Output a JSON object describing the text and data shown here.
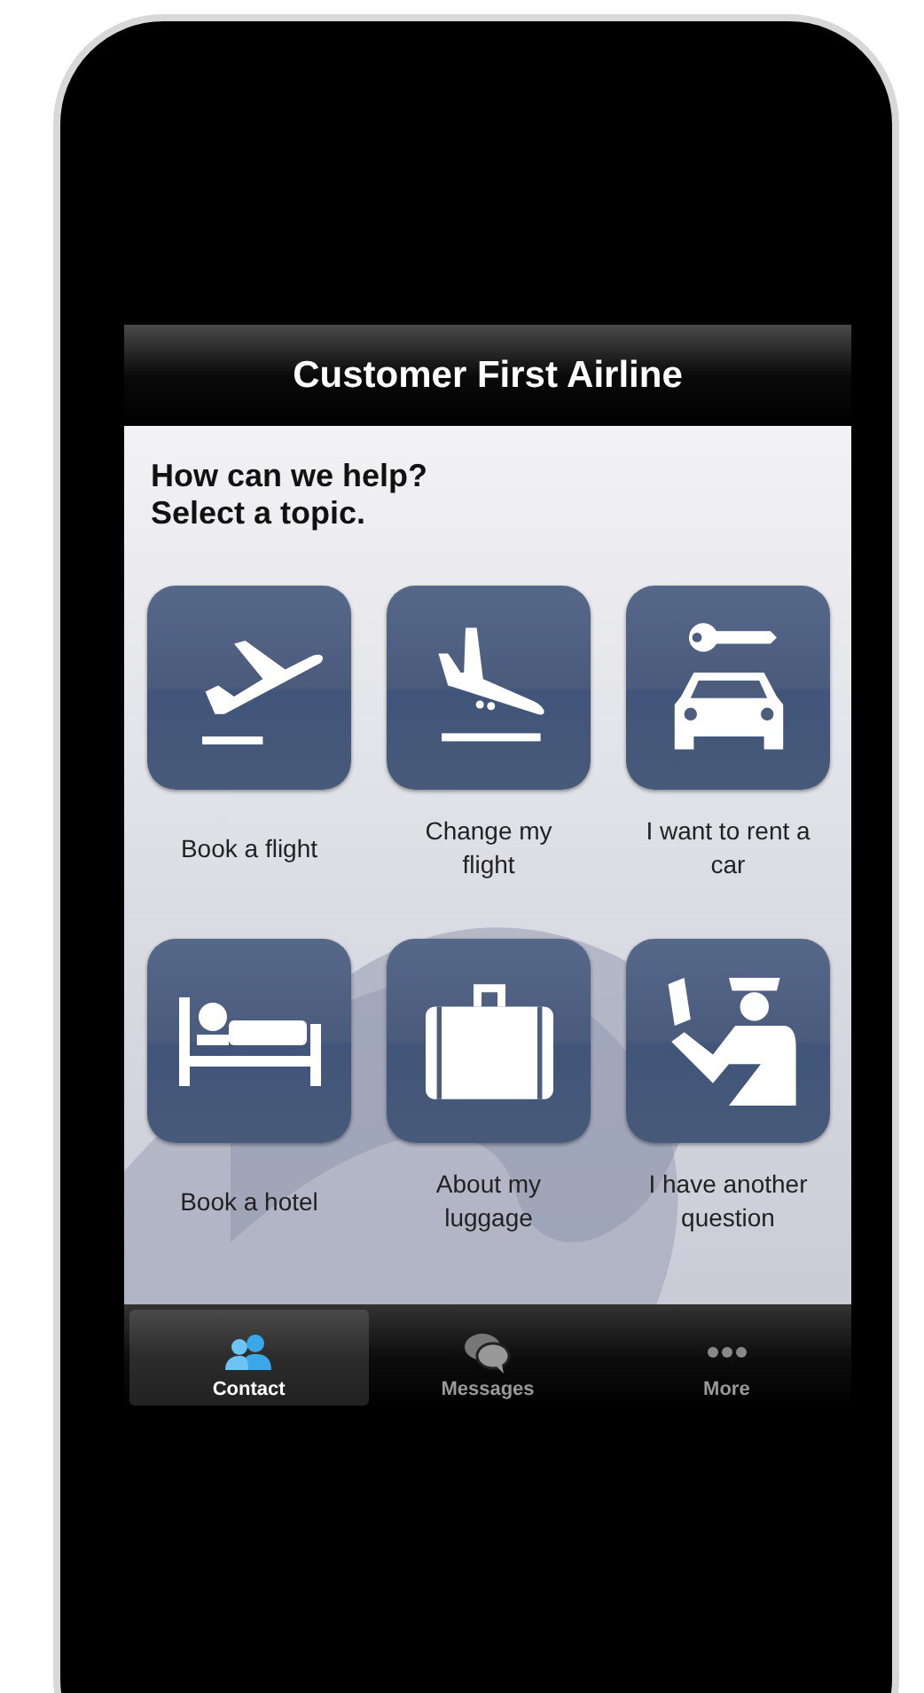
{
  "header": {
    "title": "Customer First Airline"
  },
  "prompt": [
    "How can we help?",
    "Select a topic."
  ],
  "topics": [
    {
      "kind": "takeoff",
      "label": "Book a flight"
    },
    {
      "kind": "landing",
      "label": "Change my flight"
    },
    {
      "kind": "car",
      "label": "I want to rent a car"
    },
    {
      "kind": "bed",
      "label": "Book a hotel"
    },
    {
      "kind": "luggage",
      "label": "About my luggage"
    },
    {
      "kind": "officer",
      "label": "I have another question"
    }
  ],
  "tab_bar": [
    {
      "kind": "contact",
      "label": "Contact",
      "selected": true
    },
    {
      "kind": "messages",
      "label": "Messages",
      "selected": false
    },
    {
      "kind": "more",
      "label": "More",
      "selected": false
    }
  ]
}
